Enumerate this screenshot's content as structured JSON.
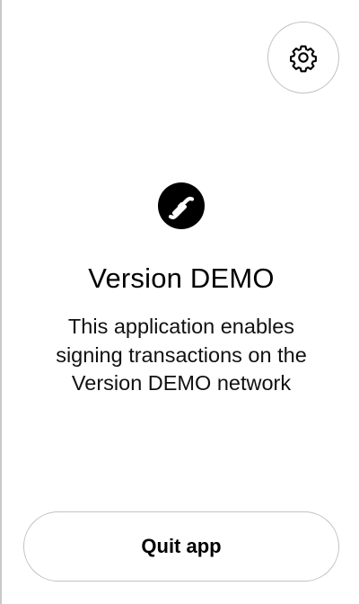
{
  "settings": {
    "icon": "gear-icon"
  },
  "app": {
    "logo_icon": "flow-logo-icon",
    "logo_color": "#000000",
    "title": "Version DEMO",
    "description_lines": [
      "This application enables",
      "signing transactions on the",
      "Version DEMO network"
    ]
  },
  "actions": {
    "quit_label": "Quit app"
  }
}
